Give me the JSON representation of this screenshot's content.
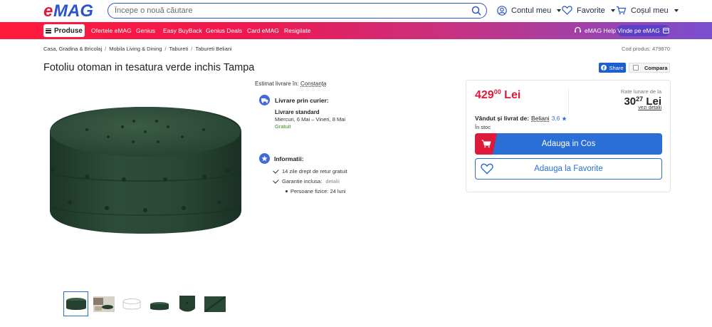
{
  "header": {
    "logo_text": "eMAG",
    "search_placeholder": "Începe o nouă căutare",
    "account_label": "Contul meu",
    "favorites_label": "Favorite",
    "cart_label": "Coșul meu"
  },
  "nav": {
    "products_label": "Produse",
    "items": [
      "Ofertele eMAG",
      "Genius",
      "Easy BuyBack",
      "Genius Deals",
      "Card eMAG",
      "Resigilate"
    ],
    "help_label": "eMAG Help",
    "sell_label": "Vinde pe eMAG"
  },
  "breadcrumb": [
    "Casa, Gradina & Bricolaj",
    "Mobila Living & Dining",
    "Tabureti",
    "Tabureti Beliani"
  ],
  "product": {
    "code": "Cod produs: 479870",
    "title": "Fotoliu otoman in tesatura verde inchis Tampa",
    "share_label": "Share",
    "compare_label": "Compara",
    "color": "#24402f"
  },
  "delivery": {
    "estimate_prefix": "Estimat livrare în:",
    "estimate_city": "Constanța",
    "courier_title": "Livrare prin curier:",
    "standard_label": "Livrare standard",
    "dates": "Miercuri, 6 Mai – Vineri, 8 Mai",
    "cost": "Gratuit"
  },
  "info": {
    "title": "Informatii:",
    "return": "14 zile drept de retur gratuit",
    "warranty_prefix": "Garantie inclusa:",
    "warranty_link": "detalii",
    "warranty_detail": "Persoane fizice: 24 luni"
  },
  "pricing": {
    "price_int": "429",
    "price_dec": "00",
    "currency": "Lei",
    "rate_label": "Rate lunare de la",
    "rate_int": "30",
    "rate_dec": "27",
    "rate_currency": "Lei",
    "rate_link": "vezi detalii",
    "sold_by_prefix": "Vândut și livrat de:",
    "seller": "Beliani",
    "seller_rating": "3.6",
    "stock": "În stoc",
    "add_to_cart": "Adauga in Cos",
    "add_to_fav": "Adauga la Favorite"
  },
  "thumbs": [
    {
      "name": "thumb-ottoman-front",
      "active": true
    },
    {
      "name": "thumb-room-scene",
      "active": false
    },
    {
      "name": "thumb-dimensions",
      "active": false
    },
    {
      "name": "thumb-ottoman-side",
      "active": false
    },
    {
      "name": "thumb-ottoman-detail",
      "active": false
    },
    {
      "name": "thumb-fabric",
      "active": false
    }
  ],
  "colors": {
    "brand_red": "#e0183a",
    "brand_blue": "#2a6fd6",
    "free_green": "#3c8a1f"
  }
}
